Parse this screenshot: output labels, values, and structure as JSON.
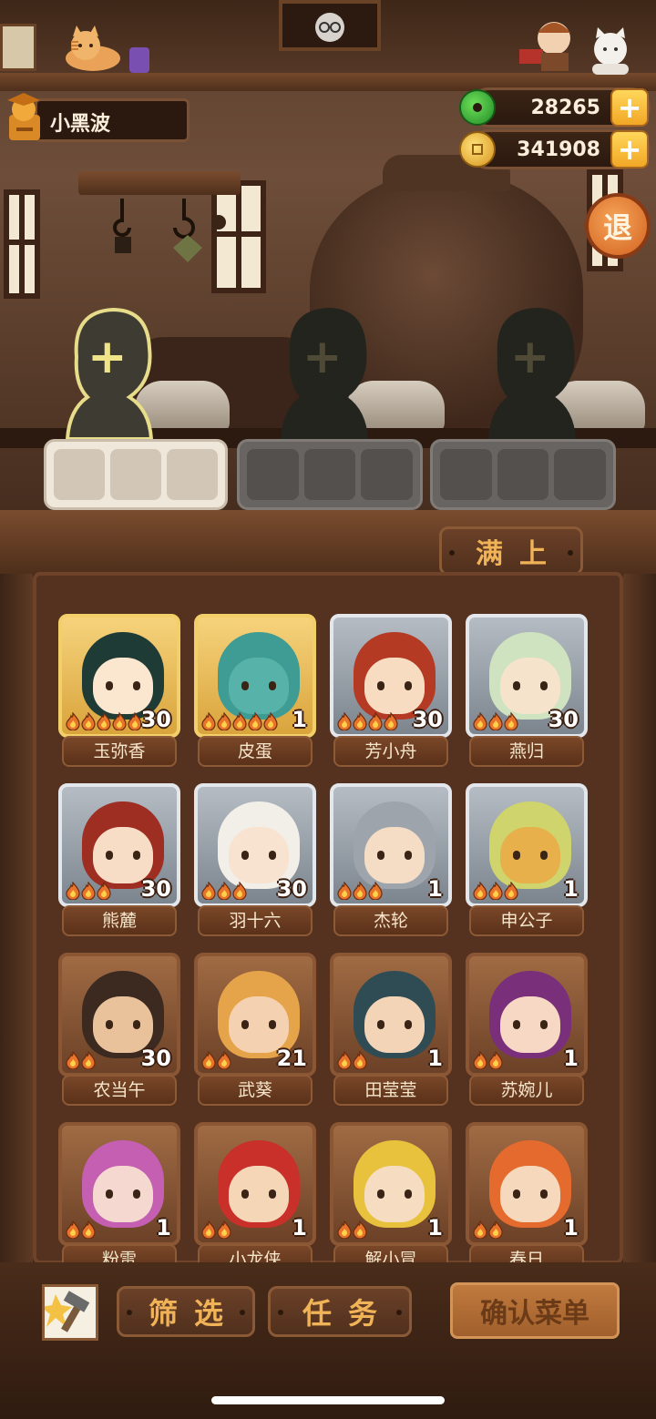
{
  "player": {
    "name": "小黑波"
  },
  "currency": {
    "jade": "28265",
    "coins": "341908",
    "add_symbol": "+"
  },
  "exit_button": {
    "label": "退"
  },
  "empty_slot_symbol": "+",
  "fill_button": {
    "label": "满上"
  },
  "bottom_bar": {
    "filter_label": "筛选",
    "task_label": "任务",
    "confirm_label": "确认菜单"
  },
  "characters": [
    {
      "name": "玉弥香",
      "level": "30",
      "stars": 5,
      "rarity": "gold",
      "hair": "#1f3b36",
      "skin": "#fbe6cf"
    },
    {
      "name": "皮蛋",
      "level": "1",
      "stars": 5,
      "rarity": "gold",
      "hair": "#3f9c94",
      "skin": "#57b3a9"
    },
    {
      "name": "芳小舟",
      "level": "30",
      "stars": 4,
      "rarity": "silver",
      "hair": "#b53a23",
      "skin": "#f7dcc2"
    },
    {
      "name": "燕归",
      "level": "30",
      "stars": 3,
      "rarity": "silver",
      "hair": "#cfe3c0",
      "skin": "#f6e3cc"
    },
    {
      "name": "熊麓",
      "level": "30",
      "stars": 3,
      "rarity": "silver",
      "hair": "#9e2d22",
      "skin": "#f8ddc6"
    },
    {
      "name": "羽十六",
      "level": "30",
      "stars": 3,
      "rarity": "silver",
      "hair": "#f2efe9",
      "skin": "#f8e2d0"
    },
    {
      "name": "杰轮",
      "level": "1",
      "stars": 3,
      "rarity": "silver",
      "hair": "#9ea4ab",
      "skin": "#f5dcc5"
    },
    {
      "name": "申公子",
      "level": "1",
      "stars": 3,
      "rarity": "silver",
      "hair": "#cfd46d",
      "skin": "#e7b04b"
    },
    {
      "name": "农当午",
      "level": "30",
      "stars": 2,
      "rarity": "bronze",
      "hair": "#3c2a20",
      "skin": "#e9c19b"
    },
    {
      "name": "武葵",
      "level": "21",
      "stars": 2,
      "rarity": "bronze",
      "hair": "#e6a44a",
      "skin": "#f4d2b1"
    },
    {
      "name": "田莹莹",
      "level": "1",
      "stars": 2,
      "rarity": "bronze",
      "hair": "#2f4c55",
      "skin": "#f3d4b6"
    },
    {
      "name": "苏婉儿",
      "level": "1",
      "stars": 2,
      "rarity": "bronze",
      "hair": "#7a2f7a",
      "skin": "#f6d8c4"
    },
    {
      "name": "粉雷",
      "level": "1",
      "stars": 2,
      "rarity": "bronze",
      "hair": "#c45fb2",
      "skin": "#f5d8cf"
    },
    {
      "name": "小龙侠",
      "level": "1",
      "stars": 2,
      "rarity": "bronze",
      "hair": "#c9302a",
      "skin": "#f5d7b8"
    },
    {
      "name": "解小冒",
      "level": "1",
      "stars": 2,
      "rarity": "bronze",
      "hair": "#e8c23c",
      "skin": "#f6dcc1"
    },
    {
      "name": "春日",
      "level": "1",
      "stars": 2,
      "rarity": "bronze",
      "hair": "#e46a2e",
      "skin": "#f6d8bd"
    }
  ]
}
